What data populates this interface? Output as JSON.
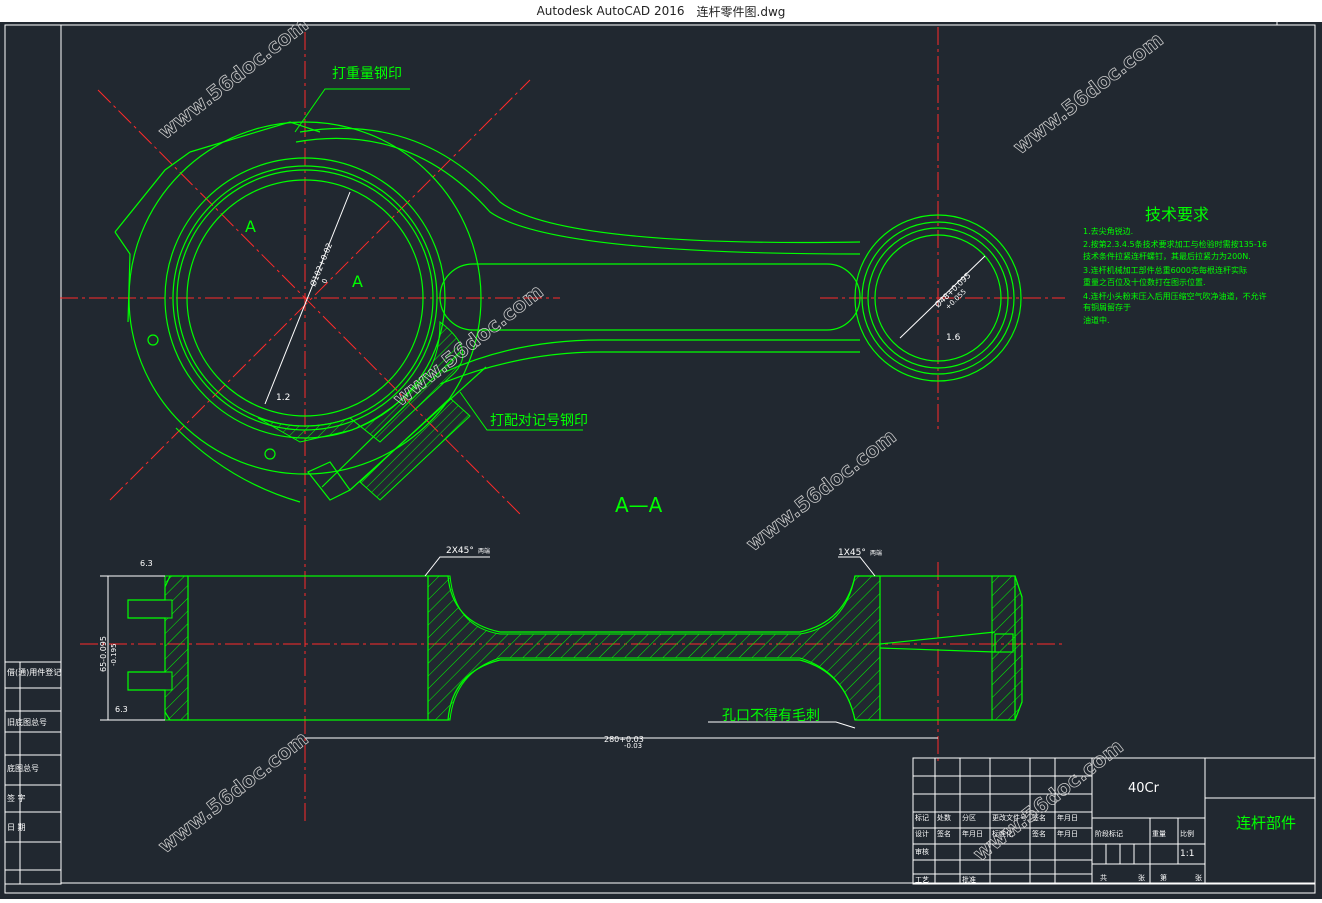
{
  "window": {
    "app_title": "Autodesk AutoCAD 2016",
    "file_name": "连杆零件图.dwg"
  },
  "drawing": {
    "label_weight_stamp": "打重量钢印",
    "label_match_stamp": "打配对记号钢印",
    "section_label": "A",
    "section_view_title": "A—A",
    "dim_big_bore": "Ø102+0.02",
    "dim_big_bore_tol": "0",
    "dim_small_bore": "Ø48+0.095",
    "dim_small_bore_tol": "+0.055",
    "roughness_big": "1.2",
    "roughness_small": "1.6",
    "roughness_side_top": "6.3",
    "roughness_side_bottom": "6.3",
    "chamfer_left": "2X45°",
    "chamfer_left_note": "两端",
    "chamfer_right": "1X45°",
    "chamfer_right_note": "两端",
    "dim_width": "65-0.095",
    "dim_width_tol": "-0.195",
    "dim_center": "280+0.03",
    "dim_center_tol": "-0.03",
    "note_burr": "孔口不得有毛刺",
    "watermark": "www.56doc.com"
  },
  "tech_requirements": {
    "title": "技术要求",
    "lines": [
      "1.去尖角锐边.",
      "2.按第2.3.4.5条技术要求加工与检验时需按135-16",
      "技术条件拉紧连杆螺钉，其最后拉紧力为200N.",
      "3.连杆机械加工部件总重6000克每根连杆实际",
      "重量之百位及十位数打在图示位置.",
      "4.连杆小头粉末压入后用压缩空气吹净油道，不允许",
      "有铜屑留存于",
      "油道中."
    ]
  },
  "title_block": {
    "material": "40Cr",
    "part_name": "连杆部件",
    "scale": "1:1",
    "row_labels": [
      "标记",
      "处数",
      "分区",
      "更改文件号",
      "签名",
      "年月日"
    ],
    "row2_labels": [
      "设计",
      "签名",
      "年月日",
      "标准化",
      "签名",
      "年月日"
    ],
    "row3_labels": [
      "审核"
    ],
    "row4_labels": [
      "工艺",
      "批准"
    ],
    "stage_labels": [
      "阶段标记",
      "重量",
      "比例"
    ],
    "bottom_labels": [
      "共",
      "张",
      "第",
      "张"
    ]
  },
  "side_strip": {
    "labels": [
      "借(通)用件登记",
      "旧底图总号",
      "底图总号",
      "签 字",
      "日 期"
    ]
  },
  "colors": {
    "background": "#212830",
    "geometry": "#00ff00",
    "centerline": "#ff2a2a",
    "dimension": "#ffffff",
    "border": "#ffffff",
    "text_green": "#00ff00",
    "watermark": "#c8c8c8"
  }
}
